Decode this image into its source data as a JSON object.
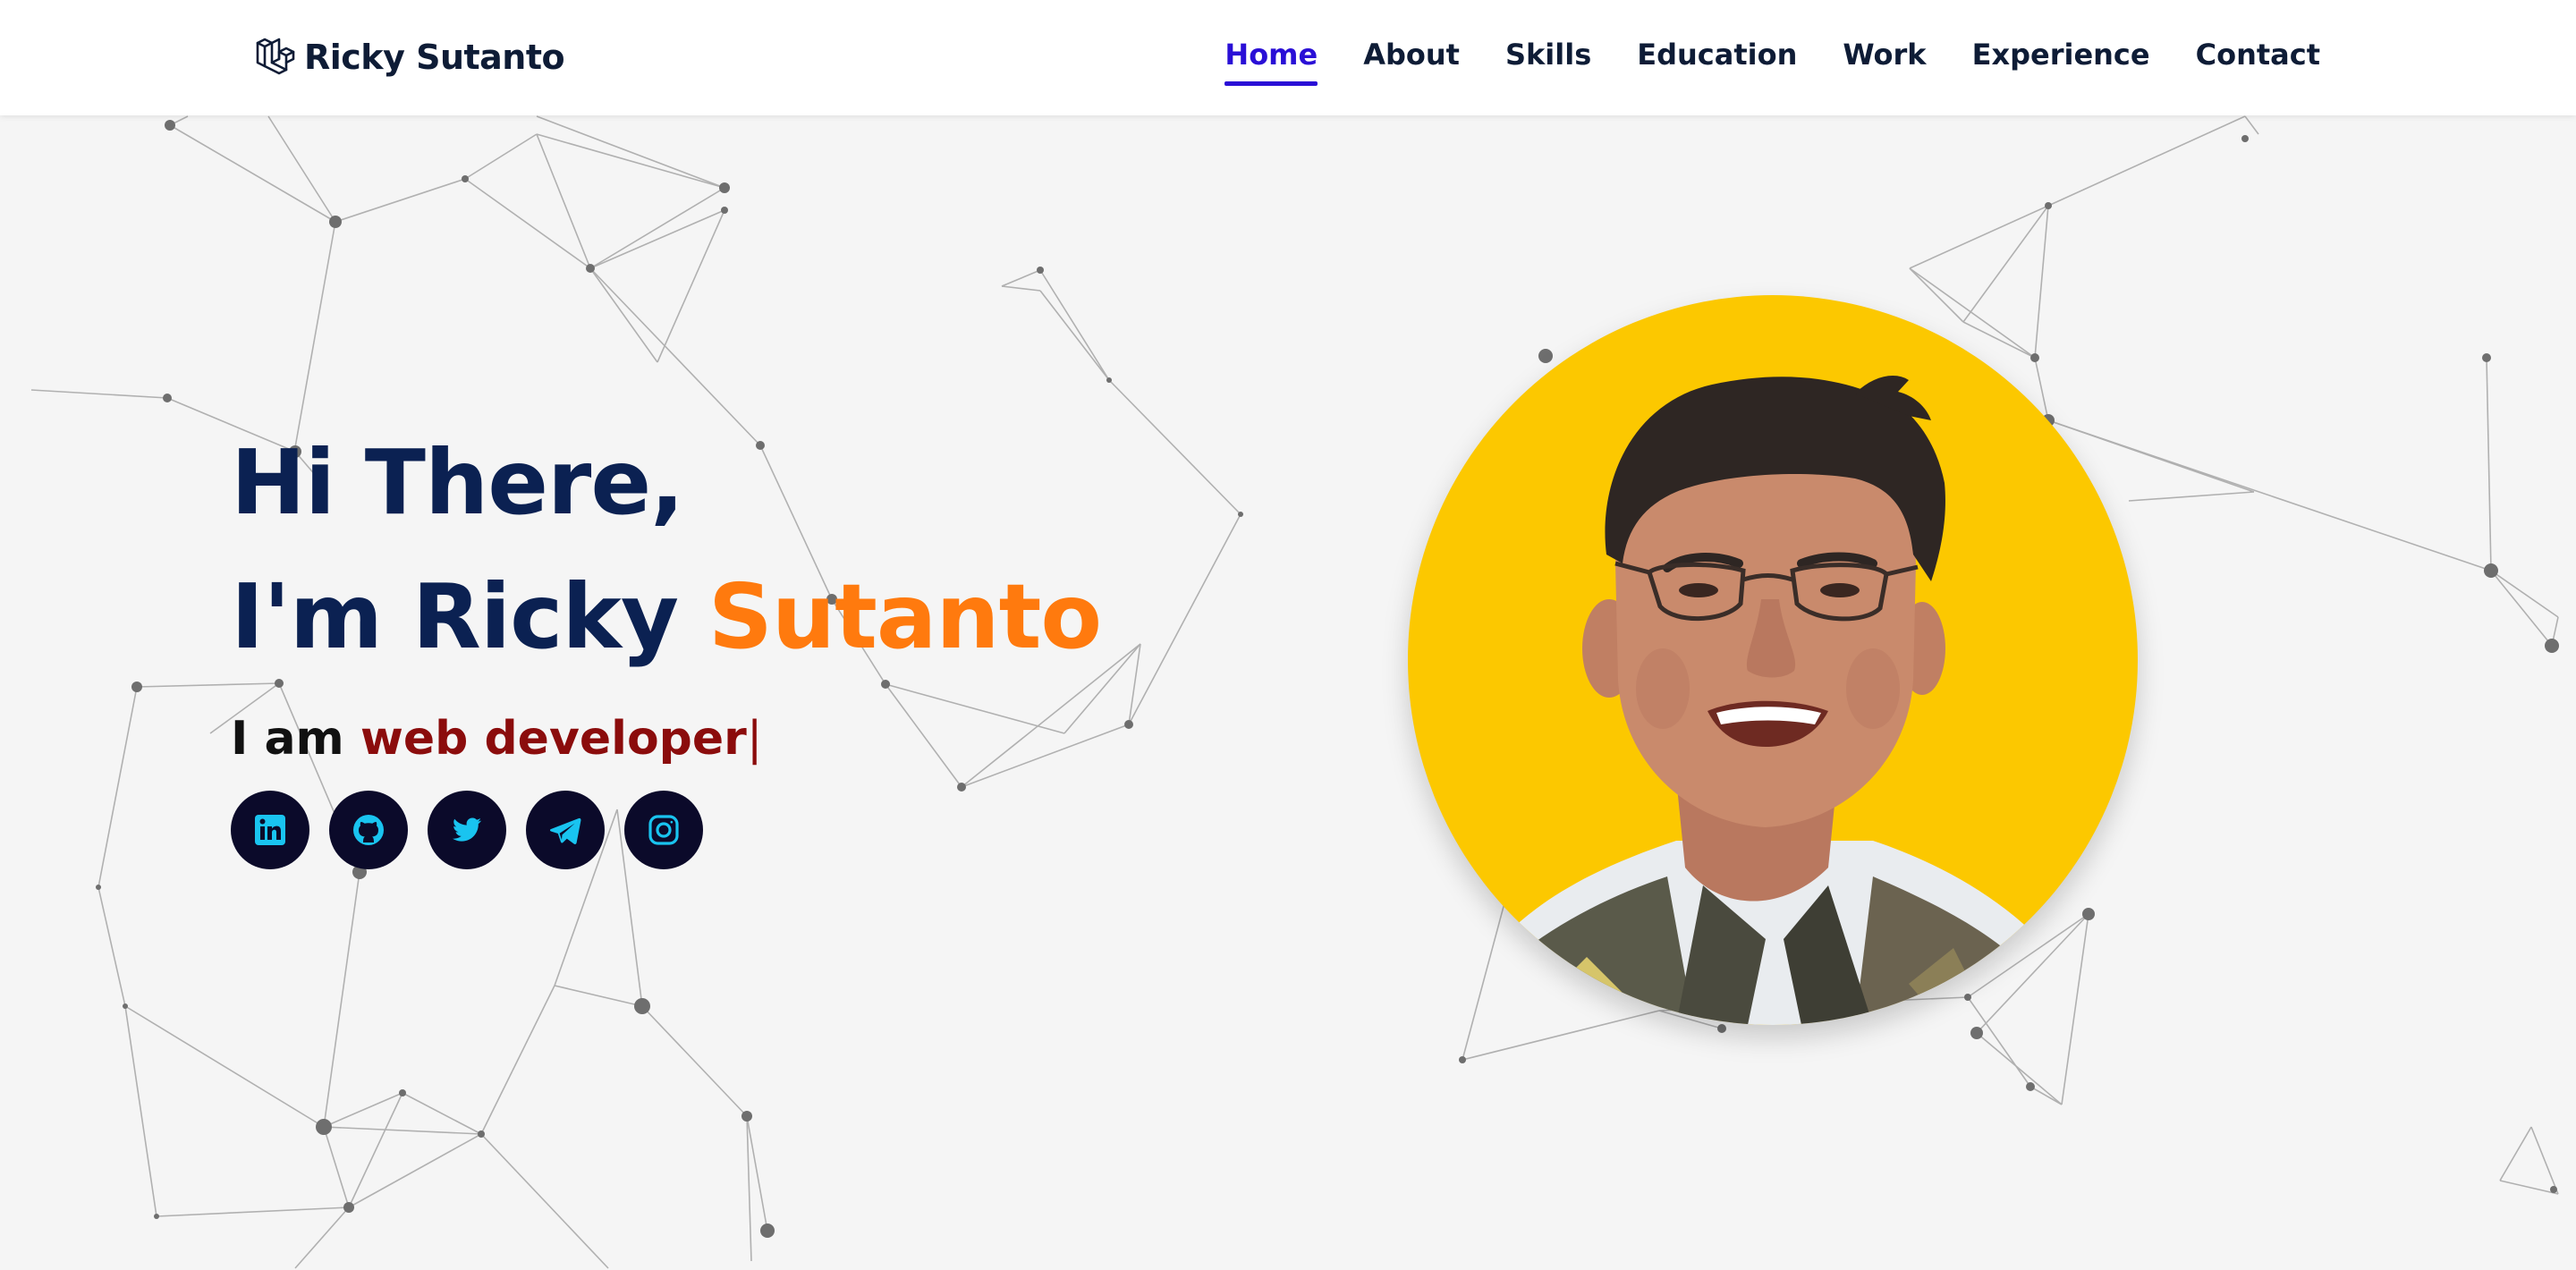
{
  "brand": {
    "name": "Ricky Sutanto",
    "icon": "laravel-logo-icon"
  },
  "nav": {
    "items": [
      {
        "label": "Home",
        "active": true
      },
      {
        "label": "About",
        "active": false
      },
      {
        "label": "Skills",
        "active": false
      },
      {
        "label": "Education",
        "active": false
      },
      {
        "label": "Work",
        "active": false
      },
      {
        "label": "Experience",
        "active": false
      },
      {
        "label": "Contact",
        "active": false
      }
    ]
  },
  "hero": {
    "greeting": "Hi There,",
    "intro_prefix": "I'm Ricky ",
    "intro_accent": "Sutanto",
    "typing_prefix": "I am ",
    "typing_role": "web developer",
    "typing_caret": "|"
  },
  "socials": [
    {
      "icon": "linkedin-icon"
    },
    {
      "icon": "github-icon"
    },
    {
      "icon": "twitter-icon"
    },
    {
      "icon": "telegram-icon"
    },
    {
      "icon": "instagram-icon"
    }
  ],
  "colors": {
    "nav_active": "#2a0fd6",
    "heading": "#0b2152",
    "accent_orange": "#ff7a0e",
    "role_red": "#8b0c0c",
    "social_bg": "#0b0a2a",
    "social_icon": "#19c4f0",
    "avatar_bg": "#fcc800",
    "page_bg": "#f5f5f5"
  }
}
